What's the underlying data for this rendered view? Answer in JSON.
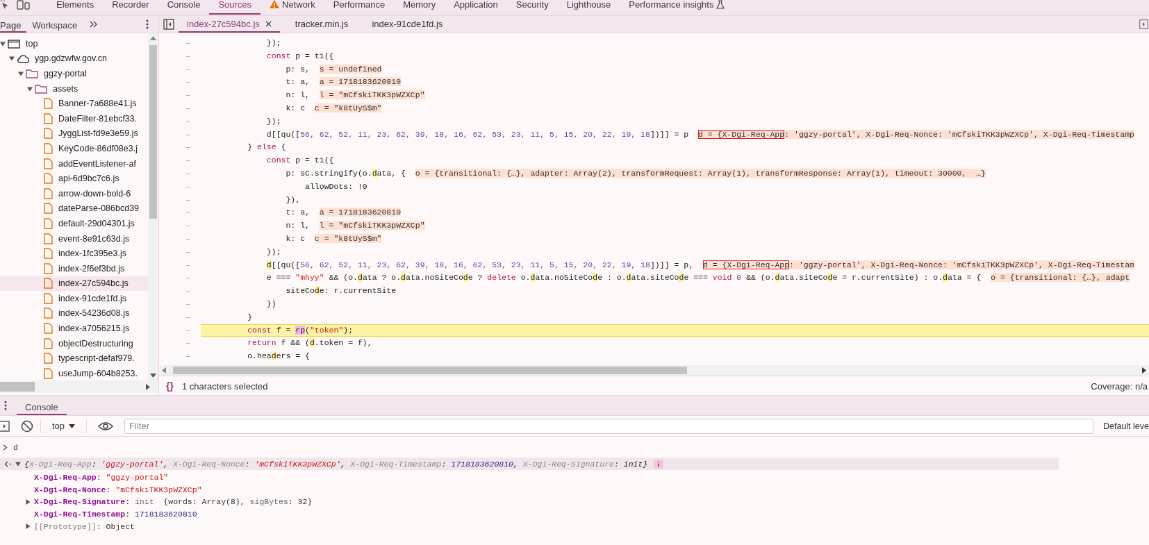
{
  "main_tabs": [
    {
      "label": "Elements",
      "selected": false,
      "kind": "plain"
    },
    {
      "label": "Recorder",
      "selected": false,
      "kind": "plain"
    },
    {
      "label": "Console",
      "selected": false,
      "kind": "plain"
    },
    {
      "label": "Sources",
      "selected": true,
      "kind": "plain"
    },
    {
      "label": "Network",
      "selected": false,
      "kind": "warning"
    },
    {
      "label": "Performance",
      "selected": false,
      "kind": "plain"
    },
    {
      "label": "Memory",
      "selected": false,
      "kind": "plain"
    },
    {
      "label": "Application",
      "selected": false,
      "kind": "plain"
    },
    {
      "label": "Security",
      "selected": false,
      "kind": "plain"
    },
    {
      "label": "Lighthouse",
      "selected": false,
      "kind": "plain"
    },
    {
      "label": "Performance insights",
      "selected": false,
      "kind": "experimental"
    }
  ],
  "navigator": {
    "tabs": [
      {
        "label": "Page",
        "selected": true
      },
      {
        "label": "Workspace",
        "selected": false
      }
    ],
    "tree": [
      {
        "label": "top",
        "kind": "frame",
        "expanded": true,
        "selected": false,
        "children": [
          {
            "label": "ygp.gdzwfw.gov.cn",
            "kind": "domain",
            "expanded": true,
            "selected": false,
            "children": [
              {
                "label": "ggzy-portal",
                "kind": "folder",
                "expanded": true,
                "selected": false,
                "children": [
                  {
                    "label": "assets",
                    "kind": "folder",
                    "expanded": true,
                    "selected": false,
                    "children": [
                      {
                        "label": "Banner-7a688e41.js",
                        "kind": "file",
                        "selected": false
                      },
                      {
                        "label": "DateFilter-81ebcf33.",
                        "kind": "file",
                        "selected": false
                      },
                      {
                        "label": "JyggList-fd9e3e59.js",
                        "kind": "file",
                        "selected": false
                      },
                      {
                        "label": "KeyCode-86df08e3.j",
                        "kind": "file",
                        "selected": false
                      },
                      {
                        "label": "addEventListener-af",
                        "kind": "file",
                        "selected": false
                      },
                      {
                        "label": "api-6d9bc7c6.js",
                        "kind": "file",
                        "selected": false
                      },
                      {
                        "label": "arrow-down-bold-6",
                        "kind": "file",
                        "selected": false
                      },
                      {
                        "label": "dateParse-086bcd39",
                        "kind": "file",
                        "selected": false
                      },
                      {
                        "label": "default-29d04301.js",
                        "kind": "file",
                        "selected": false
                      },
                      {
                        "label": "event-8e91c63d.js",
                        "kind": "file",
                        "selected": false
                      },
                      {
                        "label": "index-1fc395e3.js",
                        "kind": "file",
                        "selected": false
                      },
                      {
                        "label": "index-2f6ef3bd.js",
                        "kind": "file",
                        "selected": false
                      },
                      {
                        "label": "index-27c594bc.js",
                        "kind": "file",
                        "selected": true
                      },
                      {
                        "label": "index-91cde1fd.js",
                        "kind": "file",
                        "selected": false
                      },
                      {
                        "label": "index-54236d08.js",
                        "kind": "file",
                        "selected": false
                      },
                      {
                        "label": "index-a7056215.js",
                        "kind": "file",
                        "selected": false
                      },
                      {
                        "label": "objectDestructuring",
                        "kind": "file",
                        "selected": false
                      },
                      {
                        "label": "typescript-defaf979.",
                        "kind": "file",
                        "selected": false
                      },
                      {
                        "label": "useJump-604b8253.",
                        "kind": "file",
                        "selected": false
                      }
                    ]
                  }
                ]
              }
            ]
          }
        ]
      }
    ]
  },
  "editor": {
    "tabs": [
      {
        "label": "index-27c594bc.js",
        "selected": true,
        "closable": true
      },
      {
        "label": "tracker.min.js",
        "selected": false,
        "closable": false
      },
      {
        "label": "index-91cde1fd.js",
        "selected": false,
        "closable": false
      }
    ],
    "lines": [
      {
        "gutter": "–",
        "current": false,
        "segments": [
          {
            "kind": "plain",
            "text": "            });"
          }
        ]
      },
      {
        "gutter": "–",
        "current": false,
        "segments": [
          {
            "kind": "keyword",
            "text": "            const"
          },
          {
            "kind": "plain",
            "text": " p = t1({"
          }
        ]
      },
      {
        "gutter": "–",
        "current": false,
        "segments": [
          {
            "kind": "plain",
            "text": "                p: s,  "
          },
          {
            "kind": "value",
            "text": "s = undefined"
          }
        ]
      },
      {
        "gutter": "–",
        "current": false,
        "segments": [
          {
            "kind": "plain",
            "text": "                t: a,  "
          },
          {
            "kind": "value",
            "text": "a = 1718183620810"
          }
        ]
      },
      {
        "gutter": "–",
        "current": false,
        "segments": [
          {
            "kind": "plain",
            "text": "                n: l,  "
          },
          {
            "kind": "value",
            "text": "l = \"mCfskiTKK3pWZXCp\""
          }
        ]
      },
      {
        "gutter": "–",
        "current": false,
        "segments": [
          {
            "kind": "plain",
            "text": "                k: c  "
          },
          {
            "kind": "value",
            "text": "c = \"k8tUyS$m\""
          }
        ]
      },
      {
        "gutter": "–",
        "current": false,
        "segments": [
          {
            "kind": "plain",
            "text": "            });"
          }
        ]
      },
      {
        "gutter": "–",
        "current": false,
        "segments": [
          {
            "kind": "plain",
            "text": "            d[[qu(["
          },
          {
            "kind": "number",
            "text": "56, 62, 52, 11, 23, 62, 39, 18, 16, 62, 53, 23, 11, 5, 15, 20, 22, 19, 18"
          },
          {
            "kind": "plain",
            "text": "])]] = p  "
          },
          {
            "kind": "boxed",
            "text": "d = {X-Dgi-Req-App"
          },
          {
            "kind": "value",
            "text": ": 'ggzy-portal', X-Dgi-Req-Nonce: 'mCfskiTKK3pWZXCp', X-Dgi-Req-Timestamp"
          }
        ]
      },
      {
        "gutter": "–",
        "current": false,
        "segments": [
          {
            "kind": "plain",
            "text": "        } "
          },
          {
            "kind": "keyword",
            "text": "else"
          },
          {
            "kind": "plain",
            "text": " {"
          }
        ]
      },
      {
        "gutter": "–",
        "current": false,
        "segments": [
          {
            "kind": "keyword",
            "text": "            const"
          },
          {
            "kind": "plain",
            "text": " p = t1({"
          }
        ]
      },
      {
        "gutter": "–",
        "current": false,
        "segments": [
          {
            "kind": "plain",
            "text": "                p: sC.stringify(o."
          },
          {
            "kind": "match",
            "text": "d"
          },
          {
            "kind": "plain",
            "text": "ata, {  "
          },
          {
            "kind": "value",
            "text": "o = {transitional: {…}, adapter: Array(2), transformRequest: Array(1), transformResponse: Array(1), timeout: 30000,  …}"
          }
        ]
      },
      {
        "gutter": "–",
        "current": false,
        "segments": [
          {
            "kind": "plain",
            "text": "                    allowDots: !0"
          }
        ]
      },
      {
        "gutter": "–",
        "current": false,
        "segments": [
          {
            "kind": "plain",
            "text": "                }),"
          }
        ]
      },
      {
        "gutter": "–",
        "current": false,
        "segments": [
          {
            "kind": "plain",
            "text": "                t: a,  "
          },
          {
            "kind": "value",
            "text": "a = 1718183620810"
          }
        ]
      },
      {
        "gutter": "–",
        "current": false,
        "segments": [
          {
            "kind": "plain",
            "text": "                n: l,  "
          },
          {
            "kind": "value",
            "text": "l = \"mCfskiTKK3pWZXCp\""
          }
        ]
      },
      {
        "gutter": "–",
        "current": false,
        "segments": [
          {
            "kind": "plain",
            "text": "                k: c  "
          },
          {
            "kind": "value",
            "text": "c = \"k8tUyS$m\""
          }
        ]
      },
      {
        "gutter": "–",
        "current": false,
        "segments": [
          {
            "kind": "plain",
            "text": "            });"
          }
        ]
      },
      {
        "gutter": "–",
        "current": false,
        "segments": [
          {
            "kind": "match",
            "text": "            d"
          },
          {
            "kind": "plain",
            "text": "[[qu(["
          },
          {
            "kind": "number",
            "text": "56, 62, 52, 11, 23, 62, 39, 18, 16, 62, 53, 23, 11, 5, 15, 20, 22, 19, 18"
          },
          {
            "kind": "plain",
            "text": "])]] = p,  "
          },
          {
            "kind": "boxed",
            "text": "d = {X-Dgi-Req-App"
          },
          {
            "kind": "value",
            "text": ": 'ggzy-portal', X-Dgi-Req-Nonce: 'mCfskiTKK3pWZXCp', X-Dgi-Req-Timestam"
          }
        ]
      },
      {
        "gutter": "–",
        "current": false,
        "segments": [
          {
            "kind": "plain",
            "text": "            e === "
          },
          {
            "kind": "string",
            "text": "\"mhyy\""
          },
          {
            "kind": "plain",
            "text": " && (o."
          },
          {
            "kind": "match",
            "text": "d"
          },
          {
            "kind": "plain",
            "text": "ata ? o."
          },
          {
            "kind": "match",
            "text": "d"
          },
          {
            "kind": "plain",
            "text": "ata.noSiteCo"
          },
          {
            "kind": "match",
            "text": "d"
          },
          {
            "kind": "plain",
            "text": "e ? "
          },
          {
            "kind": "keyword",
            "text": "delete"
          },
          {
            "kind": "plain",
            "text": " o."
          },
          {
            "kind": "match",
            "text": "d"
          },
          {
            "kind": "plain",
            "text": "ata.noSiteCo"
          },
          {
            "kind": "match",
            "text": "d"
          },
          {
            "kind": "plain",
            "text": "e : o."
          },
          {
            "kind": "match",
            "text": "d"
          },
          {
            "kind": "plain",
            "text": "ata.siteCo"
          },
          {
            "kind": "match",
            "text": "d"
          },
          {
            "kind": "plain",
            "text": "e === "
          },
          {
            "kind": "keyword",
            "text": "void"
          },
          {
            "kind": "number",
            "text": " 0"
          },
          {
            "kind": "plain",
            "text": " && (o."
          },
          {
            "kind": "match",
            "text": "d"
          },
          {
            "kind": "plain",
            "text": "ata.siteCo"
          },
          {
            "kind": "match",
            "text": "d"
          },
          {
            "kind": "plain",
            "text": "e = r.currentSite) : o."
          },
          {
            "kind": "match",
            "text": "d"
          },
          {
            "kind": "plain",
            "text": "ata = {  "
          },
          {
            "kind": "value",
            "text": "o = {transitional: {…}, adapt"
          }
        ]
      },
      {
        "gutter": "–",
        "current": false,
        "segments": [
          {
            "kind": "plain",
            "text": "                siteCo"
          },
          {
            "kind": "match",
            "text": "d"
          },
          {
            "kind": "plain",
            "text": "e: r.currentSite"
          }
        ]
      },
      {
        "gutter": "–",
        "current": false,
        "segments": [
          {
            "kind": "plain",
            "text": "            })"
          }
        ]
      },
      {
        "gutter": "–",
        "current": false,
        "segments": [
          {
            "kind": "plain",
            "text": "        }"
          }
        ]
      },
      {
        "gutter": "–",
        "current": true,
        "segments": [
          {
            "kind": "keyword",
            "text": "        const"
          },
          {
            "kind": "plain",
            "text": " f = "
          },
          {
            "kind": "selection",
            "text": "rp"
          },
          {
            "kind": "plain",
            "text": "("
          },
          {
            "kind": "string",
            "text": "\"token\""
          },
          {
            "kind": "plain",
            "text": ");"
          }
        ]
      },
      {
        "gutter": "–",
        "current": false,
        "segments": [
          {
            "kind": "keyword",
            "text": "        return"
          },
          {
            "kind": "plain",
            "text": " f && ("
          },
          {
            "kind": "match",
            "text": "d"
          },
          {
            "kind": "plain",
            "text": ".token = f),"
          }
        ]
      },
      {
        "gutter": "–",
        "current": false,
        "segments": [
          {
            "kind": "plain",
            "text": "        o.hea"
          },
          {
            "kind": "match",
            "text": "d"
          },
          {
            "kind": "plain",
            "text": "ers = {"
          }
        ]
      }
    ],
    "format_icon": "{}",
    "status": "1 characters selected",
    "coverage": "Coverage: n/a"
  },
  "console": {
    "tabs": [
      {
        "label": "Console",
        "selected": true
      }
    ],
    "context": "top",
    "filter_placeholder": "Filter",
    "levels": "Default leve",
    "entries": [
      {
        "kind": "input",
        "text": "d"
      },
      {
        "kind": "result",
        "expanded": true,
        "preview": [
          {
            "kind": "plain",
            "text": "{"
          },
          {
            "kind": "key",
            "text": "X-Dgi-Req-App"
          },
          {
            "kind": "plain",
            "text": ": "
          },
          {
            "kind": "string",
            "text": "'ggzy-portal'"
          },
          {
            "kind": "plain",
            "text": ", "
          },
          {
            "kind": "key",
            "text": "X-Dgi-Req-Nonce"
          },
          {
            "kind": "plain",
            "text": ": "
          },
          {
            "kind": "string",
            "text": "'mCfskiTKK3pWZXCp'"
          },
          {
            "kind": "plain",
            "text": ", "
          },
          {
            "kind": "key",
            "text": "X-Dgi-Req-Timestamp"
          },
          {
            "kind": "plain",
            "text": ": "
          },
          {
            "kind": "number",
            "text": "1718183620810"
          },
          {
            "kind": "plain",
            "text": ", "
          },
          {
            "kind": "key",
            "text": "X-Dgi-Req-Signature"
          },
          {
            "kind": "plain",
            "text": ": "
          },
          {
            "kind": "object",
            "text": "init"
          },
          {
            "kind": "plain",
            "text": "}"
          }
        ],
        "properties": [
          {
            "kind": "leaf",
            "key": "X-Dgi-Req-App",
            "value": [
              {
                "kind": "plain",
                "text": ": "
              },
              {
                "kind": "string",
                "text": "\"ggzy-portal\""
              }
            ]
          },
          {
            "kind": "leaf",
            "key": "X-Dgi-Req-Nonce",
            "value": [
              {
                "kind": "plain",
                "text": ": "
              },
              {
                "kind": "string",
                "text": "\"mCfskiTKK3pWZXCp\""
              }
            ]
          },
          {
            "kind": "node",
            "expanded": false,
            "key": "X-Dgi-Req-Signature",
            "value": [
              {
                "kind": "plain",
                "text": ": "
              },
              {
                "kind": "dim",
                "text": "init"
              },
              {
                "kind": "plain",
                "text": "  {words: Array(8), "
              },
              {
                "kind": "dim",
                "text": "sigBytes"
              },
              {
                "kind": "plain",
                "text": ": 32}"
              }
            ]
          },
          {
            "kind": "leaf",
            "key": "X-Dgi-Req-Timestamp",
            "value": [
              {
                "kind": "plain",
                "text": ": "
              },
              {
                "kind": "number",
                "text": "1718183620810"
              }
            ]
          },
          {
            "kind": "internal",
            "expanded": false,
            "key": "[[Prototype]]",
            "value": [
              {
                "kind": "plain",
                "text": ": Object"
              }
            ]
          }
        ]
      }
    ]
  }
}
